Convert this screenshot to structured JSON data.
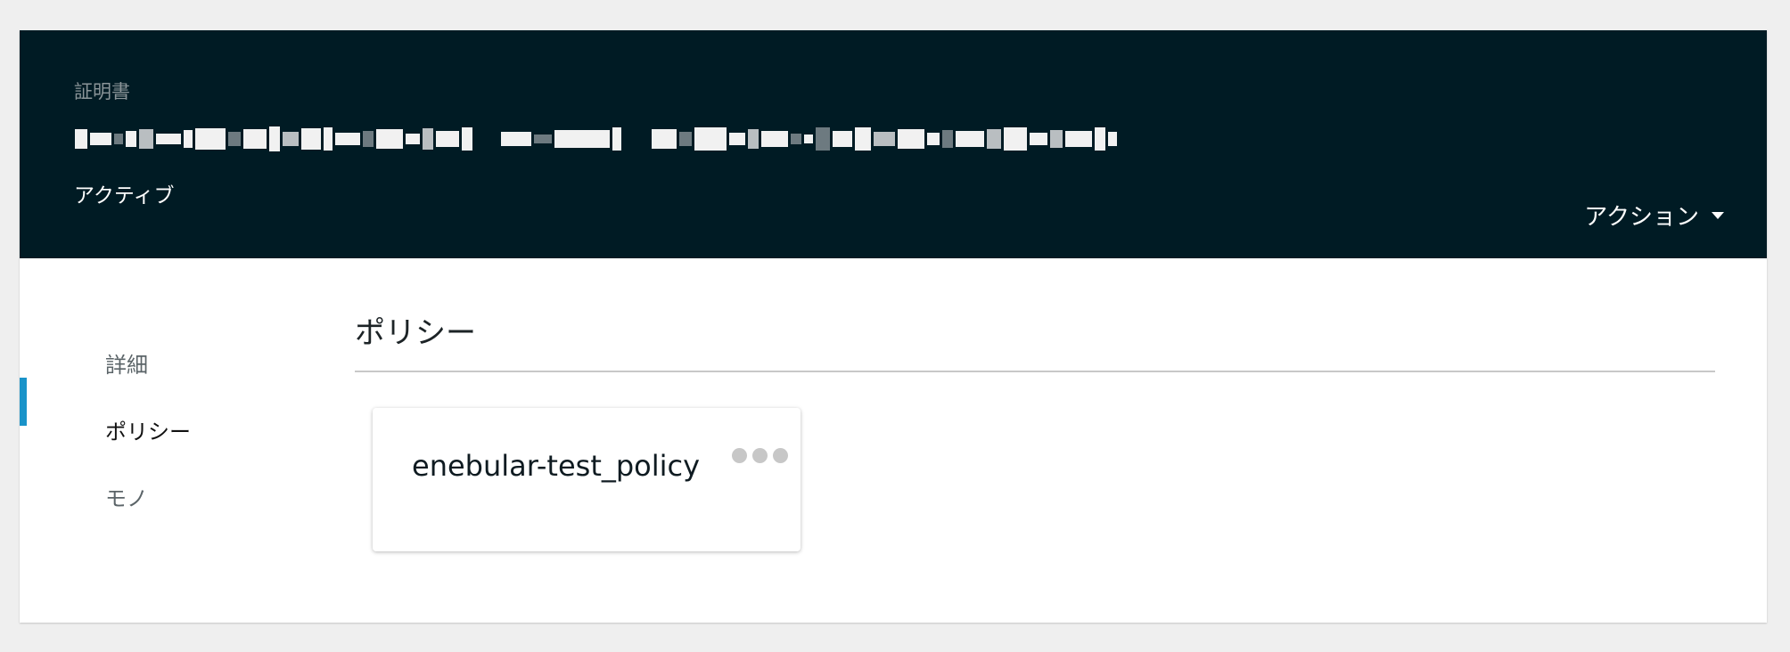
{
  "header": {
    "label": "証明書",
    "status": "アクティブ",
    "actions_label": "アクション",
    "background_color": "#001b24"
  },
  "sidenav": {
    "items": [
      {
        "label": "詳細",
        "active": false
      },
      {
        "label": "ポリシー",
        "active": true
      },
      {
        "label": "モノ",
        "active": false
      }
    ],
    "active_indicator_color": "#1a93c9"
  },
  "section": {
    "title": "ポリシー"
  },
  "policies": [
    {
      "name": "enebular-test_policy",
      "menu_icon": "more-horizontal-icon"
    }
  ],
  "icons": {
    "actions_caret": "caret-down-icon",
    "card_menu": "ellipsis-icon"
  }
}
